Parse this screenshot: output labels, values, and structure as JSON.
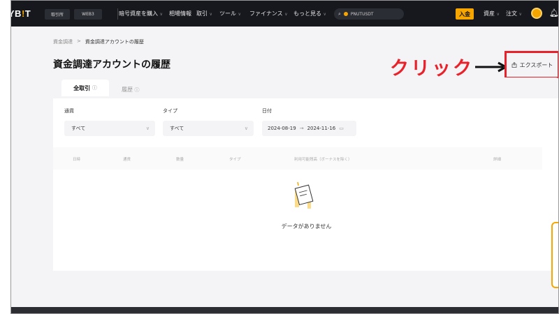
{
  "nav": {
    "logo_left": "BYB",
    "logo_bar": "!",
    "logo_right": "T",
    "exchange_tab": "取引所",
    "web3_tab": "WEB3",
    "links": [
      "暗号資産を購入",
      "相場情報",
      "取引",
      "ツール",
      "ファイナンス",
      "もっと見る"
    ],
    "search_placeholder": "PNUTUSDT",
    "deposit_label": "入金",
    "assets_label": "資産",
    "orders_label": "注文"
  },
  "breadcrumb": {
    "parent": "資金調達",
    "separator": ">",
    "current": "資金調達アカウントの履歴"
  },
  "page": {
    "title": "資金調達アカウントの履歴",
    "export_label": "エクスポート"
  },
  "annotation": {
    "text": "クリック"
  },
  "tabs": {
    "all_trades": "全取引",
    "history": "履歴"
  },
  "filters": {
    "currency_label": "通貨",
    "currency_value": "すべて",
    "type_label": "タイプ",
    "type_value": "すべて",
    "date_label": "日付",
    "date_from": "2024-08-19",
    "date_arrow": "→",
    "date_to": "2024-11-16"
  },
  "table": {
    "headers": [
      "日時",
      "通貨",
      "数量",
      "タイプ",
      "利用可能残高（ボーナスを除く）",
      "詳細"
    ]
  },
  "empty_state": {
    "text": "データがありません"
  },
  "colors": {
    "brand": "#f7a600",
    "annotation": "#e8212b",
    "nav_bg": "#17181e"
  }
}
